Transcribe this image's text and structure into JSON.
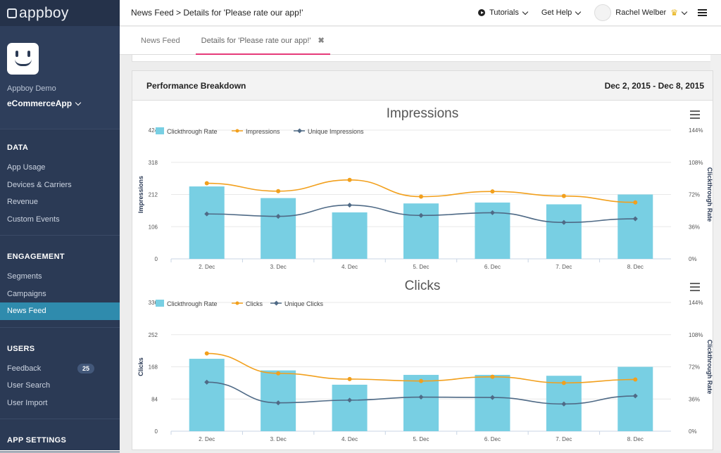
{
  "brand": {
    "name": "appboy"
  },
  "app": {
    "company": "Appboy Demo",
    "name": "eCommerceApp"
  },
  "nav": [
    {
      "heading": "DATA",
      "items": [
        {
          "label": "App Usage"
        },
        {
          "label": "Devices & Carriers"
        },
        {
          "label": "Revenue"
        },
        {
          "label": "Custom Events"
        }
      ]
    },
    {
      "heading": "ENGAGEMENT",
      "items": [
        {
          "label": "Segments"
        },
        {
          "label": "Campaigns"
        },
        {
          "label": "News Feed",
          "active": true
        }
      ]
    },
    {
      "heading": "USERS",
      "items": [
        {
          "label": "Feedback",
          "badge": "25"
        },
        {
          "label": "User Search"
        },
        {
          "label": "User Import"
        }
      ]
    },
    {
      "heading": "APP SETTINGS",
      "items": []
    }
  ],
  "topbar": {
    "breadcrumb": "News Feed > Details for 'Please rate our app!'",
    "tutorials": "Tutorials",
    "help": "Get Help",
    "user": "Rachel Welber",
    "crown": "♛"
  },
  "tabs": [
    {
      "label": "News Feed"
    },
    {
      "label": "Details for 'Please rate our app!'",
      "close": "✖"
    }
  ],
  "panel": {
    "title": "Performance Breakdown",
    "date_range": "Dec 2, 2015 - Dec 8, 2015"
  },
  "colors": {
    "bar": "#78cfe3",
    "orange": "#f2a01d",
    "slate": "#4f6a86",
    "accent": "#e63a7a",
    "sidebar": "#2b3a55",
    "active": "#2f8bad"
  },
  "chart_data": [
    {
      "type": "bar",
      "title": "Impressions",
      "categories": [
        "2. Dec",
        "3. Dec",
        "4. Dec",
        "5. Dec",
        "6. Dec",
        "7. Dec",
        "8. Dec"
      ],
      "ylabel": "Impressions",
      "ylabel_right": "Clickthrough Rate",
      "ylim": [
        0,
        424
      ],
      "y_ticks": [
        "0",
        "106",
        "212",
        "318",
        "424"
      ],
      "y2lim": [
        0,
        144
      ],
      "y2_ticks": [
        "0%",
        "36%",
        "72%",
        "108%",
        "144%"
      ],
      "legend": [
        "Clickthrough Rate",
        "Impressions",
        "Unique Impressions"
      ],
      "series": [
        {
          "name": "Clickthrough Rate",
          "kind": "bar",
          "axis": "right",
          "values": [
            81,
            68,
            52,
            62,
            63,
            61,
            72
          ]
        },
        {
          "name": "Impressions",
          "kind": "line",
          "axis": "left",
          "values": [
            249,
            223,
            260,
            205,
            222,
            207,
            186
          ]
        },
        {
          "name": "Unique Impressions",
          "kind": "line",
          "axis": "left",
          "values": [
            148,
            140,
            177,
            143,
            152,
            120,
            132
          ]
        }
      ]
    },
    {
      "type": "bar",
      "title": "Clicks",
      "categories": [
        "2. Dec",
        "3. Dec",
        "4. Dec",
        "5. Dec",
        "6. Dec",
        "7. Dec",
        "8. Dec"
      ],
      "ylabel": "Clicks",
      "ylabel_right": "Clickthrough Rate",
      "ylim": [
        0,
        336
      ],
      "y_ticks": [
        "0",
        "84",
        "168",
        "252",
        "336"
      ],
      "y2lim": [
        0,
        144
      ],
      "y2_ticks": [
        "0%",
        "36%",
        "72%",
        "108%",
        "144%"
      ],
      "legend": [
        "Clickthrough Rate",
        "Clicks",
        "Unique Clicks"
      ],
      "series": [
        {
          "name": "Clickthrough Rate",
          "kind": "bar",
          "axis": "right",
          "values": [
            81,
            68,
            52,
            63,
            63,
            62,
            72
          ]
        },
        {
          "name": "Clicks",
          "kind": "line",
          "axis": "left",
          "values": [
            203,
            151,
            136,
            131,
            142,
            126,
            135
          ]
        },
        {
          "name": "Unique Clicks",
          "kind": "line",
          "axis": "left",
          "values": [
            128,
            74,
            81,
            89,
            88,
            71,
            92
          ]
        }
      ]
    }
  ]
}
